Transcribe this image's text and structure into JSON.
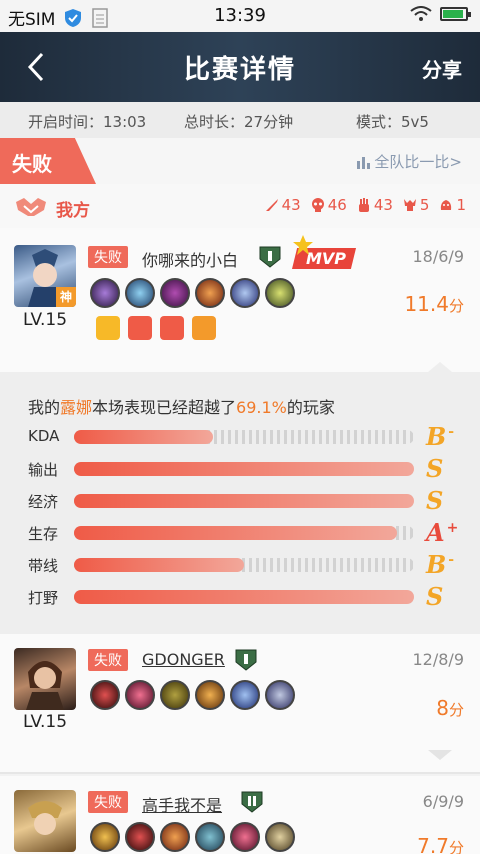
{
  "status_bar": {
    "carrier": "无SIM",
    "time": "13:39"
  },
  "header": {
    "title": "比赛详情",
    "share": "分享"
  },
  "info": {
    "start_time": "开启时间：13:03",
    "duration": "总时长：27分钟",
    "mode": "模式：5v5"
  },
  "result": {
    "label": "失败",
    "compare": "全队比一比>"
  },
  "team": {
    "name": "我方",
    "stats": [
      {
        "icon": "kill-icon",
        "value": "43"
      },
      {
        "icon": "death-icon",
        "value": "46"
      },
      {
        "icon": "assist-icon",
        "value": "43"
      },
      {
        "icon": "tower-icon",
        "value": "5"
      },
      {
        "icon": "dragon-icon",
        "value": "1"
      }
    ]
  },
  "players": [
    {
      "result": "失败",
      "name": "你哪来的小白",
      "mvp": "MVP",
      "level": "LV.15",
      "date": "18/6/9",
      "score": "11.4",
      "score_unit": "分",
      "tag_badge": "神"
    },
    {
      "result": "失败",
      "name": "GDONGER",
      "level": "LV.15",
      "date": "12/8/9",
      "score": "8",
      "score_unit": "分"
    },
    {
      "result": "失败",
      "name": "高手我不是",
      "date": "6/9/9",
      "score": "7.7",
      "score_unit": "分"
    }
  ],
  "detail": {
    "prefix": "我的",
    "hero": "露娜",
    "middle": "本场表现已经超越了",
    "percent": "69.1%",
    "suffix": "的玩家",
    "metrics": [
      {
        "label": "KDA",
        "fill": 0.41,
        "grade": "B",
        "mod": "-"
      },
      {
        "label": "输出",
        "fill": 1.0,
        "grade": "S",
        "mod": ""
      },
      {
        "label": "经济",
        "fill": 1.0,
        "grade": "S",
        "mod": ""
      },
      {
        "label": "生存",
        "fill": 0.95,
        "grade": "A",
        "mod": "+"
      },
      {
        "label": "带线",
        "fill": 0.5,
        "grade": "B",
        "mod": "-"
      },
      {
        "label": "打野",
        "fill": 1.0,
        "grade": "S",
        "mod": ""
      }
    ]
  },
  "colors": {
    "accent": "#ef6a5a",
    "score": "#f07a2a",
    "header": "#24354a"
  }
}
